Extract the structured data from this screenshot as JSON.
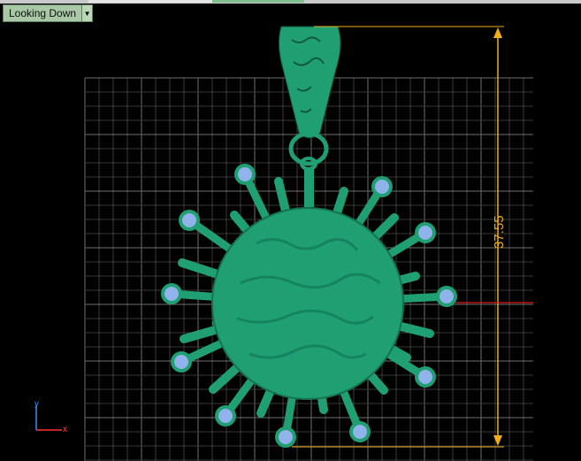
{
  "viewport": {
    "view_name": "Looking Down",
    "dropdown_icon": "triangle-down",
    "dimension_value": "37.55",
    "axis_labels": {
      "x": "x",
      "y": "y"
    }
  },
  "colors": {
    "background": "#000000",
    "grid_minor": "#3b3b3b",
    "grid_major": "#6f6f6f",
    "model": "#1f9f72",
    "model_dark": "#13664a",
    "spike_tip": "#8fb3ea",
    "dimension": "#f0ad18",
    "x_axis": "#ff3030",
    "y_axis": "#3a8cff"
  }
}
